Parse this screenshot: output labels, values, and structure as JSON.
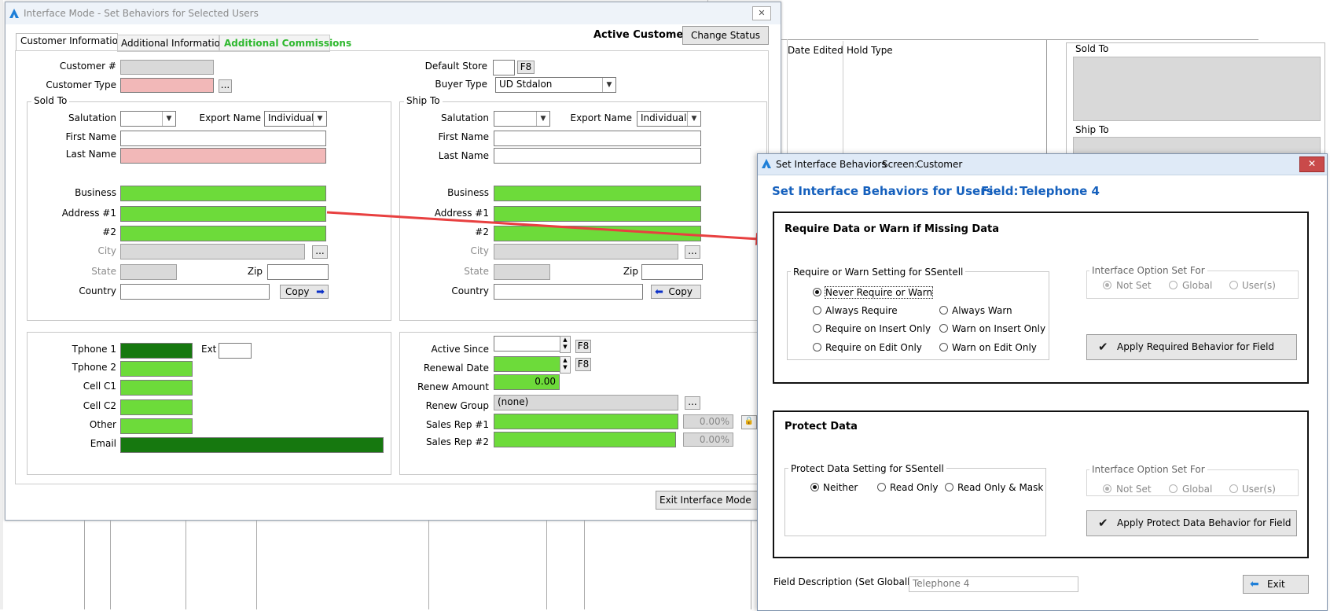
{
  "main_window": {
    "title": "Interface Mode - Set Behaviors for Selected Users",
    "tabs": [
      "Customer Information",
      "Additional Information",
      "Additional Commissions"
    ],
    "status": "Active Customer",
    "change_status": "Change Status",
    "exit_interface_mode": "Exit Interface Mode"
  },
  "customer": {
    "customer_no_label": "Customer #",
    "customer_type_label": "Customer Type",
    "default_store_label": "Default Store",
    "f8": "F8",
    "buyer_type_label": "Buyer Type",
    "buyer_type_value": "UD Stdalon",
    "ellipsis": "...",
    "sold_to": "Sold To",
    "ship_to": "Ship To",
    "salutation": "Salutation",
    "export_name": "Export Name",
    "export_value": "Individual",
    "first_name": "First Name",
    "last_name": "Last Name",
    "business": "Business",
    "address1": "Address #1",
    "address2": "#2",
    "city": "City",
    "state": "State",
    "zip": "Zip",
    "country": "Country",
    "copy": "Copy"
  },
  "contact": {
    "tphone1": "Tphone 1",
    "ext": "Ext",
    "tphone2": "Tphone 2",
    "cell1": "Cell C1",
    "cell2": "Cell C2",
    "other": "Other",
    "email": "Email"
  },
  "account": {
    "active_since": "Active Since",
    "renewal_date": "Renewal Date",
    "renew_amount": "Renew Amount",
    "renew_amount_value": "0.00",
    "renew_group": "Renew Group",
    "renew_group_value": "(none)",
    "sales_rep1": "Sales Rep #1",
    "sales_rep1_pct": "0.00%",
    "sales_rep2": "Sales Rep #2",
    "sales_rep2_pct": "0.00%"
  },
  "background": {
    "date_edited": "Date Edited",
    "hold_type": "Hold Type",
    "sold_to": "Sold To",
    "ship_to": "Ship To"
  },
  "dialog": {
    "title": "Set Interface Behaviors",
    "screen_label": "Screen:",
    "screen_value": "Customer",
    "heading": "Set Interface Behaviors for Users",
    "field_label": "Field:",
    "field_value": "Telephone 4",
    "require_section": "Require Data or Warn if Missing Data",
    "require_group": "Require or Warn Setting for SSentell",
    "require_options": [
      "Never Require or Warn",
      "Always Require",
      "Require on Insert Only",
      "Require on Edit Only",
      "Always Warn",
      "Warn on Insert Only",
      "Warn on Edit Only"
    ],
    "require_selected": "Never Require or Warn",
    "option_set_for": "Interface Option Set For",
    "set_for_options": [
      "Not Set",
      "Global",
      "User(s)"
    ],
    "apply_required": "Apply Required Behavior for Field",
    "protect_section": "Protect Data",
    "protect_group": "Protect Data Setting for SSentell",
    "protect_options": [
      "Neither",
      "Read Only",
      "Read Only & Mask"
    ],
    "protect_selected": "Neither",
    "apply_protect": "Apply Protect Data Behavior for Field",
    "field_description_label": "Field Description (Set Globally)",
    "field_description_value": "Telephone 4",
    "exit": "Exit"
  },
  "colors": {
    "required_pink": "#f2b8b8",
    "green": "#6ddb3a",
    "dark_green": "#16780f",
    "blue_heading": "#1560bd",
    "arrow_red": "#e84040"
  }
}
